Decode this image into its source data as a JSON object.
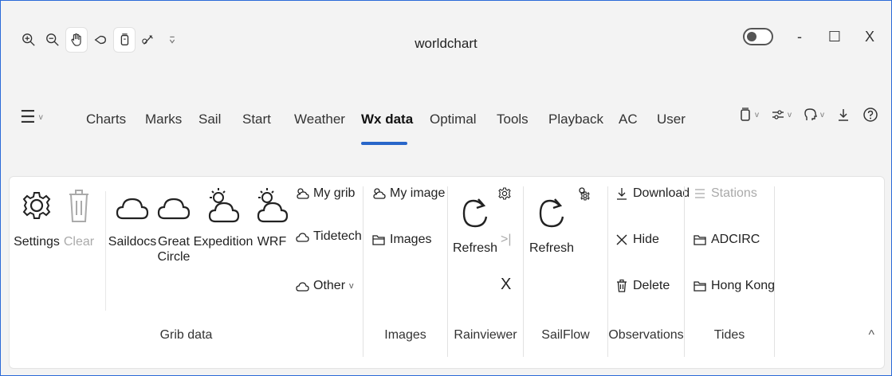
{
  "window": {
    "title": "worldchart",
    "minimize": "-",
    "maximize": "☐",
    "close": "X"
  },
  "quick_access": {
    "icons": [
      "zoom-in-icon",
      "zoom-out-icon",
      "hand-icon",
      "lasso-icon",
      "device-icon",
      "pen-icon",
      "more-icon"
    ]
  },
  "menu": {
    "glyph": "☰",
    "chev": "v"
  },
  "tabs": [
    {
      "label": "Charts",
      "active": false
    },
    {
      "label": "Marks",
      "active": false
    },
    {
      "label": "Sail",
      "active": false
    },
    {
      "label": "Start",
      "active": false
    },
    {
      "label": "Weather",
      "active": false
    },
    {
      "label": "Wx data",
      "active": true
    },
    {
      "label": "Optimal",
      "active": false
    },
    {
      "label": "Tools",
      "active": false
    },
    {
      "label": "Playback",
      "active": false
    },
    {
      "label": "AC",
      "active": false
    },
    {
      "label": "User",
      "active": false
    }
  ],
  "ribbon": {
    "grib": {
      "label": "Grib data",
      "settings": "Settings",
      "clear": "Clear",
      "saildocs": "Saildocs",
      "great_circle_1": "Great",
      "great_circle_2": "Circle",
      "expedition": "Expedition",
      "wrf": "WRF",
      "my_grib": "My grib",
      "tidetech": "Tidetech",
      "other": "Other",
      "other_chev": "v"
    },
    "images": {
      "label": "Images",
      "my_image": "My image",
      "images": "Images"
    },
    "rainviewer": {
      "label": "Rainviewer",
      "refresh": "Refresh",
      "step": ">|",
      "close": "X"
    },
    "sailflow": {
      "label": "SailFlow",
      "refresh": "Refresh"
    },
    "observations": {
      "label": "Observations",
      "download": "Download",
      "hide": "Hide",
      "delete": "Delete"
    },
    "tides": {
      "label": "Tides",
      "stations": "Stations",
      "adcirc": "ADCIRC",
      "hong_kong": "Hong Kong"
    },
    "collapse": "^"
  },
  "colors": {
    "accent": "#2866c9",
    "border": "#2b6ad8",
    "disabled": "#aaaaaa"
  }
}
